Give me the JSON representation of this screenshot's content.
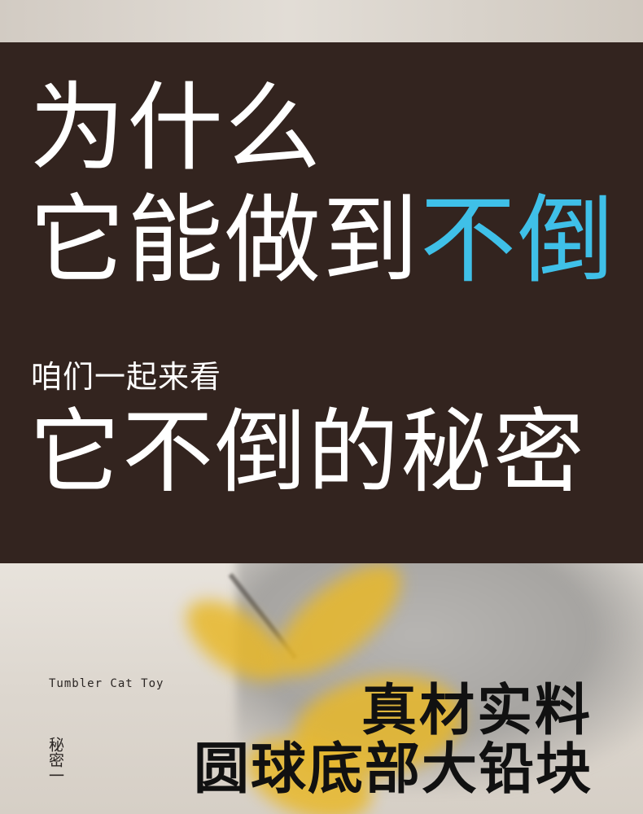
{
  "headline": {
    "line1": "为什么",
    "line2_prefix": "它能做到",
    "line2_accent": "不倒",
    "subline": "咱们一起来看",
    "line3": "它不倒的秘密"
  },
  "colors": {
    "panel_bg": "#33241f",
    "headline_text": "#ffffff",
    "accent": "#3fc0e8"
  },
  "footer": {
    "english_label": "Tumbler Cat Toy",
    "vertical_label": "秘密一",
    "title_line1": "真材实料",
    "title_line2": "圆球底部大铅块"
  }
}
